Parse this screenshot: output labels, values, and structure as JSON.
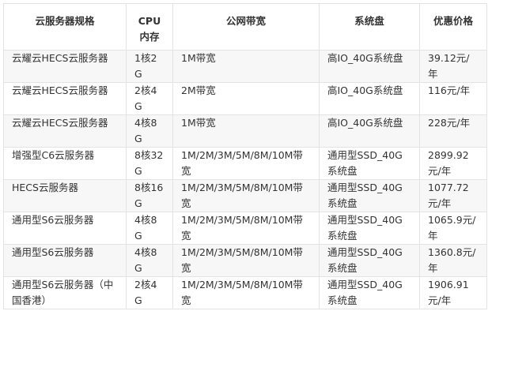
{
  "table": {
    "headers": [
      "云服务器规格",
      "CPU内存",
      "公网带宽",
      "系统盘",
      "优惠价格"
    ],
    "rows": [
      [
        "云耀云HECS云服务器",
        "1核2G",
        "1M带宽",
        "高IO_40G系统盘",
        "39.12元/年"
      ],
      [
        "云耀云HECS云服务器",
        "2核4G",
        "2M带宽",
        "高IO_40G系统盘",
        "116元/年"
      ],
      [
        "云耀云HECS云服务器",
        "4核8G",
        "1M带宽",
        "高IO_40G系统盘",
        "228元/年"
      ],
      [
        "增强型C6云服务器",
        "8核32G",
        "1M/2M/3M/5M/8M/10M带宽",
        "通用型SSD_40G系统盘",
        "2899.92元/年"
      ],
      [
        "HECS云服务器",
        "8核16G",
        "1M/2M/3M/5M/8M/10M带宽",
        "通用型SSD_40G系统盘",
        "1077.72元/年"
      ],
      [
        "通用型S6云服务器",
        "4核8G",
        "1M/2M/3M/5M/8M/10M带宽",
        "通用型SSD_40G系统盘",
        "1065.9元/年"
      ],
      [
        "通用型S6云服务器",
        "4核8G",
        "1M/2M/3M/5M/8M/10M带宽",
        "通用型SSD_40G系统盘",
        "1360.8元/年"
      ],
      [
        "通用型S6云服务器（中国香港）",
        "2核4G",
        "1M/2M/3M/5M/8M/10M带宽",
        "通用型SSD_40G系统盘",
        "1906.91元/年"
      ]
    ]
  }
}
